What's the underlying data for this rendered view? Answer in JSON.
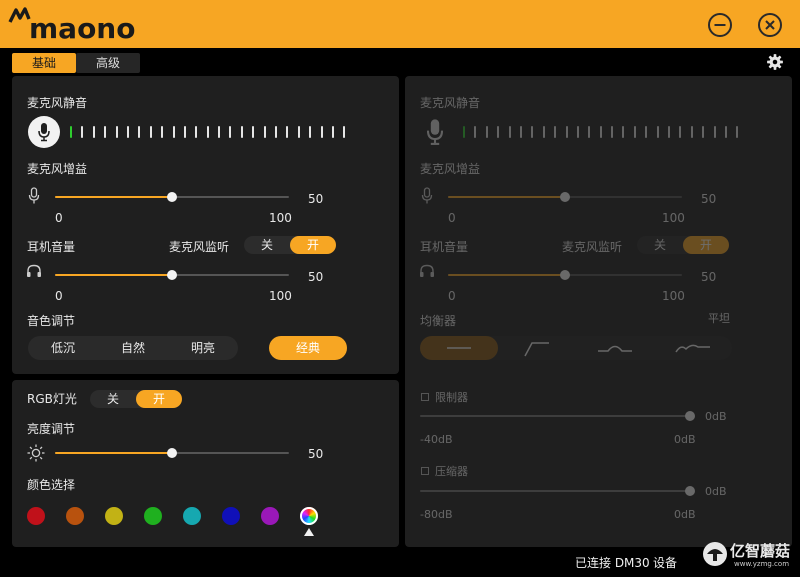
{
  "app": {
    "brand": "maono"
  },
  "tabs": [
    {
      "label": "基础",
      "active": true
    },
    {
      "label": "高级",
      "active": false
    }
  ],
  "basic": {
    "mic_mute": {
      "label": "麦克风静音",
      "meter_ticks": 25,
      "meter_active": 1
    },
    "mic_gain": {
      "label": "麦克风增益",
      "value": "50",
      "min": "0",
      "max": "100",
      "level": 0.5
    },
    "headphone": {
      "label": "耳机音量",
      "value": "50",
      "min": "0",
      "max": "100",
      "level": 0.5
    },
    "monitor": {
      "label": "麦克风监听",
      "off": "关",
      "on": "开",
      "state": "on"
    },
    "tone": {
      "label": "音色调节",
      "options": [
        "低沉",
        "自然",
        "明亮"
      ],
      "classic": "经典"
    },
    "rgb": {
      "label": "RGB灯光",
      "off": "关",
      "on": "开",
      "state": "on"
    },
    "brightness": {
      "label": "亮度调节",
      "value": "50",
      "level": 0.5
    },
    "color": {
      "label": "颜色选择",
      "swatches": [
        "#c0111a",
        "#b8520e",
        "#c2b215",
        "#1fb01f",
        "#16a8b0",
        "#1010b8",
        "#9a18b8",
        "rainbow"
      ],
      "selected": 7
    }
  },
  "advanced": {
    "mic_mute": {
      "label": "麦克风静音"
    },
    "mic_gain": {
      "label": "麦克风增益",
      "value": "50",
      "min": "0",
      "max": "100",
      "level": 0.5
    },
    "headphone": {
      "label": "耳机音量",
      "value": "50",
      "min": "0",
      "max": "100",
      "level": 0.5
    },
    "monitor": {
      "label": "麦克风监听",
      "off": "关",
      "on": "开"
    },
    "eq": {
      "label": "均衡器",
      "preset": "平坦"
    },
    "limiter": {
      "label": "限制器",
      "value": "0dB",
      "min": "-40dB",
      "max": "0dB",
      "level": 1.0
    },
    "compressor": {
      "label": "压缩器",
      "value": "0dB",
      "min": "-80dB",
      "max": "0dB",
      "level": 1.0
    }
  },
  "status": {
    "connected": "已连接 DM30",
    "device": "设备"
  },
  "watermark": {
    "text": "亿智蘑菇",
    "url": "www.yzmg.com"
  },
  "colors": {
    "accent": "#f7a623",
    "panel": "#1f1f1f",
    "background": "#000000"
  }
}
